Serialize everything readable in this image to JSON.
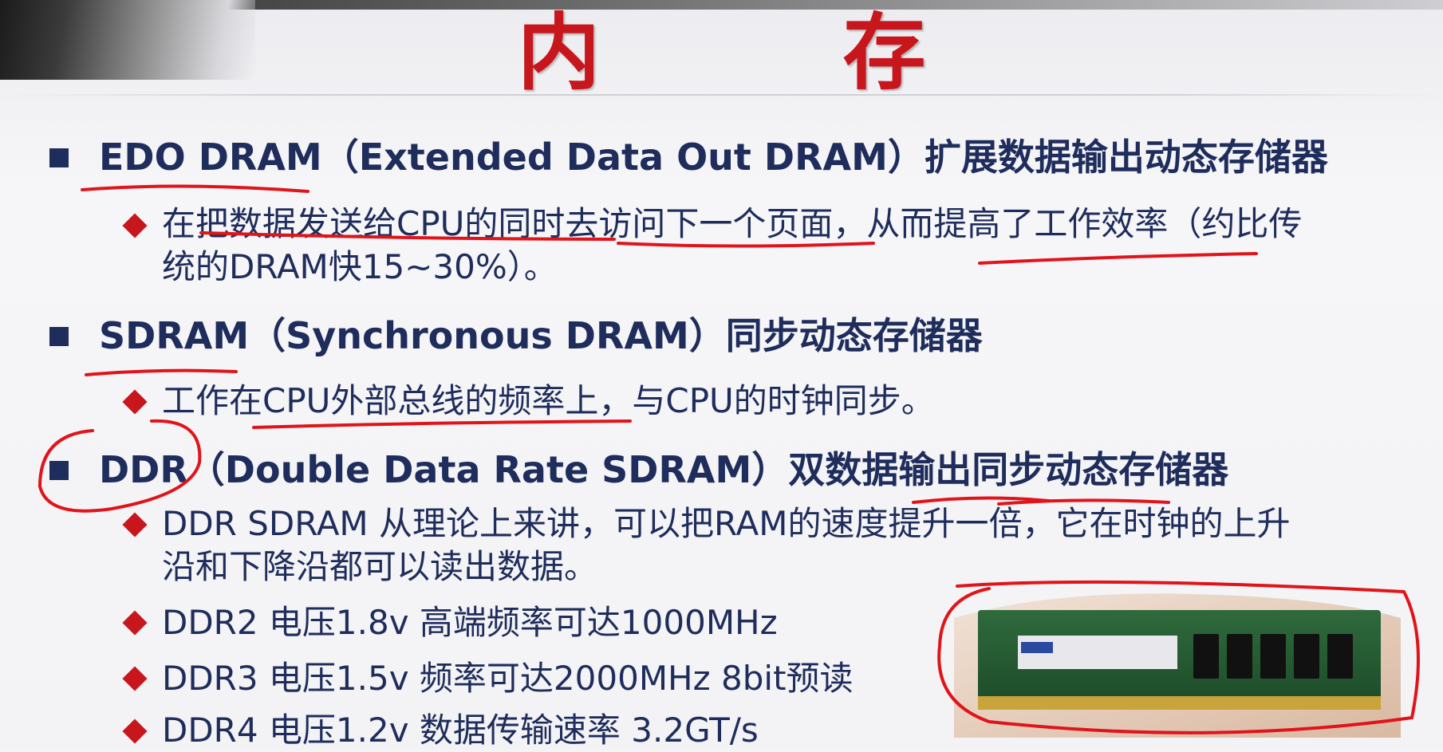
{
  "title": "内　存",
  "sections": [
    {
      "heading": "EDO DRAM（Extended Data Out DRAM）扩展数据输出动态存储器",
      "points": [
        "在把数据发送给CPU的同时去访问下一个页面，从而提高了工作效率（约比传",
        "统的DRAM快15~30%）。"
      ]
    },
    {
      "heading": "SDRAM（Synchronous DRAM）同步动态存储器",
      "points": [
        "工作在CPU外部总线的频率上，与CPU的时钟同步。"
      ]
    },
    {
      "heading": "DDR（Double Data Rate SDRAM）双数据输出同步动态存储器",
      "points": [
        "DDR SDRAM 从理论上来讲，可以把RAM的速度提升一倍，它在时钟的上升",
        "沿和下降沿都可以读出数据。",
        "DDR2 电压1.8v 高端频率可达1000MHz",
        "DDR3 电压1.5v 频率可达2000MHz  8bit预读",
        "DDR4 电压1.2v 数据传输速率 3.2GT/s"
      ]
    }
  ],
  "colors": {
    "title": "#c8161d",
    "text": "#1f2d5c",
    "bullet_diamond": "#c8161d",
    "annotation_ink": "#e0141a"
  },
  "icons": [
    "square-bullet-icon",
    "diamond-bullet-icon"
  ]
}
